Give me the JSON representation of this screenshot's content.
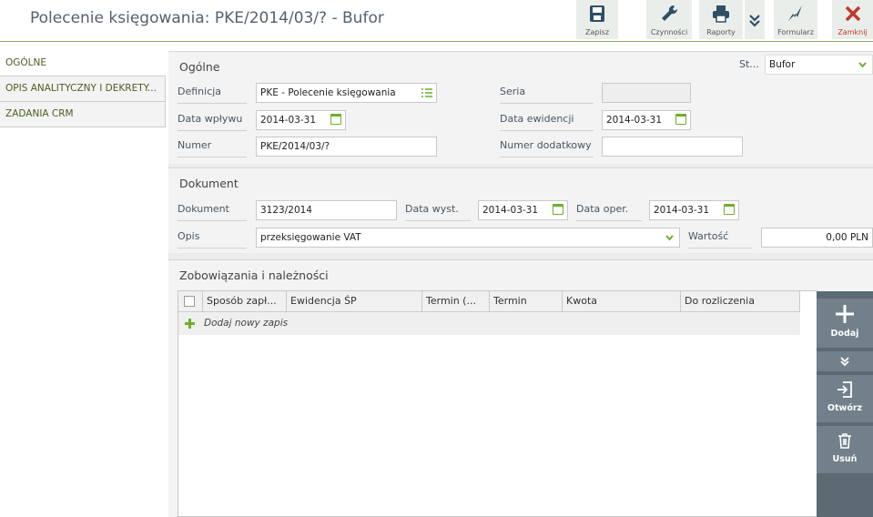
{
  "title": "Polecenie księgowania: PKE/2014/03/? - Bufor",
  "toolbar": {
    "save": "Zapisz",
    "actions": "Czynności",
    "reports": "Raporty",
    "form": "Formularz",
    "close": "Zamknij"
  },
  "sidebar": {
    "items": [
      {
        "label": "OGÓLNE"
      },
      {
        "label": "OPIS ANALITYCZNY I DEKRETY..."
      },
      {
        "label": "ZADANIA CRM"
      }
    ]
  },
  "general": {
    "title": "Ogólne",
    "status_label": "St...",
    "status_value": "Bufor",
    "definicja_label": "Definicja",
    "definicja_value": "PKE - Polecenie księgowania",
    "seria_label": "Seria",
    "seria_value": "",
    "data_wplywu_label": "Data wpływu",
    "data_wplywu_value": "2014-03-31",
    "data_ewidencji_label": "Data ewidencji",
    "data_ewidencji_value": "2014-03-31",
    "numer_label": "Numer",
    "numer_value": "PKE/2014/03/?",
    "numer_dodatkowy_label": "Numer dodatkowy",
    "numer_dodatkowy_value": ""
  },
  "document": {
    "title": "Dokument",
    "dokument_label": "Dokument",
    "dokument_value": "3123/2014",
    "data_wyst_label": "Data wyst.",
    "data_wyst_value": "2014-03-31",
    "data_oper_label": "Data oper.",
    "data_oper_value": "2014-03-31",
    "opis_label": "Opis",
    "opis_value": "przeksięgowanie VAT",
    "wartosc_label": "Wartość",
    "wartosc_value": "0,00 PLN"
  },
  "obligations": {
    "title": "Zobowiązania i należności",
    "columns": [
      "Sposób zapł...",
      "Ewidencja ŚP",
      "Termin (...",
      "Termin",
      "Kwota",
      "Do rozliczenia"
    ],
    "add_row": "Dodaj nowy zapis",
    "buttons": {
      "add": "Dodaj",
      "open": "Otwórz",
      "delete": "Usuń"
    }
  },
  "colors": {
    "accent_green": "#6fae2b",
    "close_red": "#c0392b",
    "side_panel": "#5c6a73"
  }
}
